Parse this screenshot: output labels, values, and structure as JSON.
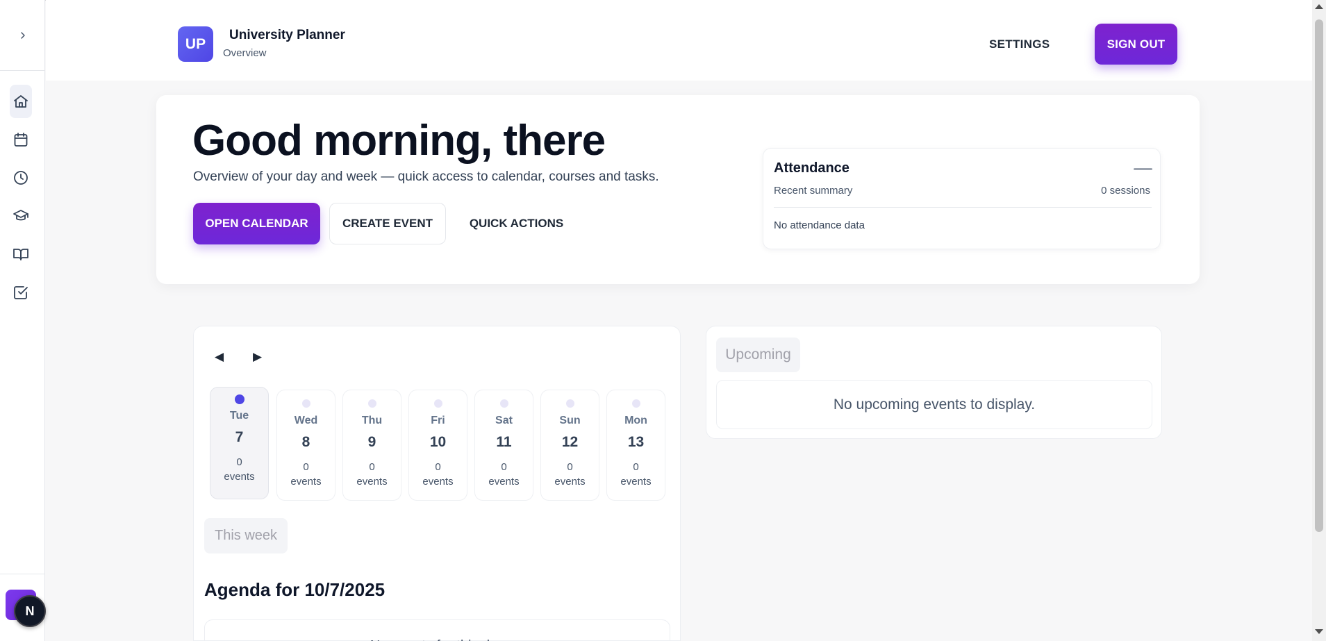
{
  "header": {
    "logo_text": "UP",
    "app_title": "University Planner",
    "subtitle": "Overview",
    "settings_label": "SETTINGS",
    "signout_label": "SIGN OUT"
  },
  "sidebar": {
    "toggle_icon": "chevron-right-icon",
    "items": [
      {
        "icon": "home-icon",
        "active": true
      },
      {
        "icon": "calendar-icon",
        "active": false
      },
      {
        "icon": "clock-icon",
        "active": false
      },
      {
        "icon": "graduation-cap-icon",
        "active": false
      },
      {
        "icon": "book-open-icon",
        "active": false
      },
      {
        "icon": "check-square-icon",
        "active": false
      }
    ],
    "badge_letter": "N"
  },
  "hero": {
    "greeting": "Good morning, there",
    "subtitle": "Overview of your day and week — quick access to calendar, courses and tasks.",
    "open_calendar_label": "OPEN CALENDAR",
    "create_event_label": "CREATE EVENT",
    "quick_actions_label": "QUICK ACTIONS"
  },
  "attendance": {
    "title": "Attendance",
    "recent_label": "Recent summary",
    "session_count": "0 sessions",
    "empty_text": "No attendance data"
  },
  "week": {
    "prev_glyph": "◀",
    "next_glyph": "▶",
    "days": [
      {
        "name": "Tue",
        "num": "7",
        "count": "0",
        "unit": "events",
        "today": true
      },
      {
        "name": "Wed",
        "num": "8",
        "count": "0",
        "unit": "events",
        "today": false
      },
      {
        "name": "Thu",
        "num": "9",
        "count": "0",
        "unit": "events",
        "today": false
      },
      {
        "name": "Fri",
        "num": "10",
        "count": "0",
        "unit": "events",
        "today": false
      },
      {
        "name": "Sat",
        "num": "11",
        "count": "0",
        "unit": "events",
        "today": false
      },
      {
        "name": "Sun",
        "num": "12",
        "count": "0",
        "unit": "events",
        "today": false
      },
      {
        "name": "Mon",
        "num": "13",
        "count": "0",
        "unit": "events",
        "today": false
      }
    ],
    "this_week_label": "This week",
    "agenda_title": "Agenda for 10/7/2025",
    "agenda_empty": "No events for this day"
  },
  "upcoming": {
    "tag": "Upcoming",
    "empty_text": "No upcoming events to display."
  },
  "colors": {
    "accent": "#6d28d9",
    "logo": "#4f46e5",
    "today_dot": "#4f46e5"
  }
}
